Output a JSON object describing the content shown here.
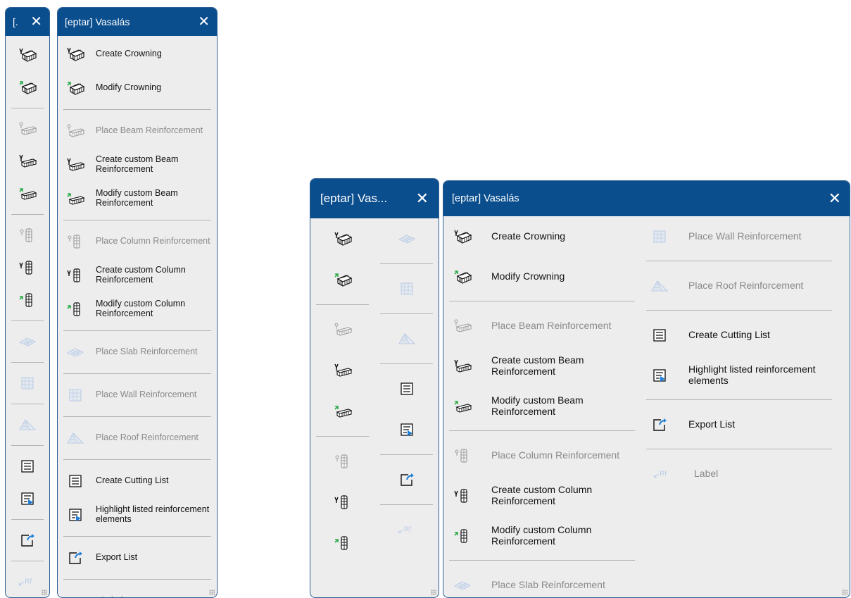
{
  "panels": {
    "narrow_small": {
      "title": "[.",
      "close": "✕"
    },
    "list_small": {
      "title": "[eptar] Vasalás",
      "close": "✕"
    },
    "narrow_big": {
      "title": "[eptar] Vas...",
      "close": "✕"
    },
    "list_big": {
      "title": "[eptar] Vasalás",
      "close": "✕"
    }
  },
  "items": {
    "create_crowning": "Create Crowning",
    "modify_crowning": "Modify Crowning",
    "place_beam": "Place Beam Reinforcement",
    "create_custom_beam": "Create custom Beam Reinforcement",
    "modify_custom_beam": "Modify custom Beam Reinforcement",
    "place_column": "Place Column Reinforcement",
    "create_custom_column": "Create custom Column Reinforcement",
    "modify_custom_column": "Modify custom Column Reinforcement",
    "place_slab": "Place Slab Reinforcement",
    "place_wall": "Place Wall Reinforcement",
    "place_roof": "Place Roof Reinforcement",
    "create_cutting_list": "Create Cutting List",
    "highlight_listed": "Highlight listed reinforcement elements",
    "export_list": "Export List",
    "label": "Label"
  },
  "label_icon_text": "Rf",
  "colors": {
    "titlebar": "#0a4e8e",
    "panel_bg": "#ededed",
    "accent_green": "#2eaa4a",
    "accent_blue": "#1f7fd8"
  }
}
